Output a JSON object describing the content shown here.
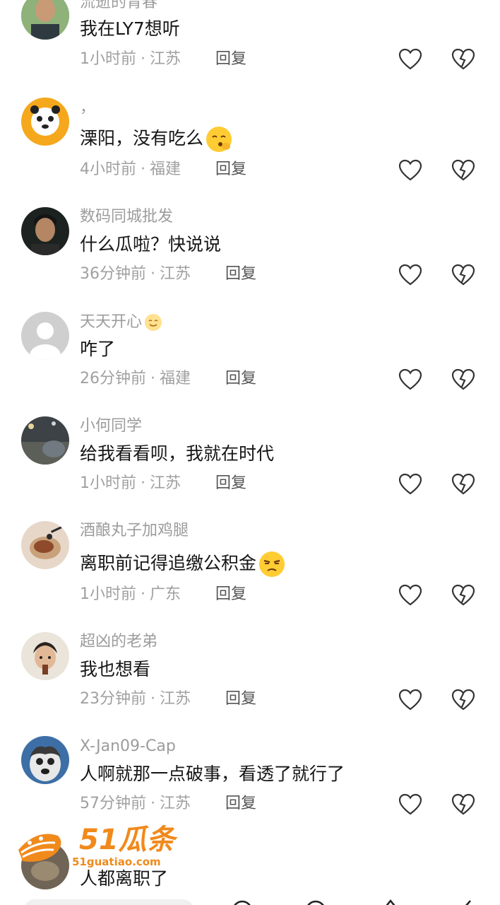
{
  "comments": [
    {
      "username": "流逝的青春",
      "text": "我在LY7想听",
      "time": "1小时前",
      "location": "江苏",
      "reply": "回复"
    },
    {
      "username": "，",
      "text": "溧阳，没有吃么",
      "time": "4小时前",
      "location": "福建",
      "reply": "回复"
    },
    {
      "username": "数码同城批发",
      "text": "什么瓜啦？快说说",
      "time": "36分钟前",
      "location": "江苏",
      "reply": "回复"
    },
    {
      "username": "天天开心",
      "text": "咋了",
      "time": "26分钟前",
      "location": "福建",
      "reply": "回复"
    },
    {
      "username": "小何同学",
      "text": "给我看看呗，我就在时代",
      "time": "1小时前",
      "location": "江苏",
      "reply": "回复"
    },
    {
      "username": "酒酿丸子加鸡腿",
      "text": "离职前记得追缴公积金",
      "time": "1小时前",
      "location": "广东",
      "reply": "回复"
    },
    {
      "username": "超凶的老弟",
      "text": "我也想看",
      "time": "23分钟前",
      "location": "江苏",
      "reply": "回复"
    },
    {
      "username": "X-Jan09-Cap",
      "text": "人啊就那一点破事，看透了就行了",
      "time": "57分钟前",
      "location": "江苏",
      "reply": "回复"
    },
    {
      "username": "",
      "text": "人都离职了",
      "time": "",
      "location": "",
      "reply": ""
    }
  ],
  "watermark": {
    "brand": "51瓜条",
    "url": "51guatiao.com"
  },
  "icons": {
    "like": "heart-outline-icon",
    "dislike": "broken-heart-icon"
  },
  "colors": {
    "accent_watermark": "#f08a1c",
    "text": "#161616",
    "meta": "#a0a0a0"
  }
}
